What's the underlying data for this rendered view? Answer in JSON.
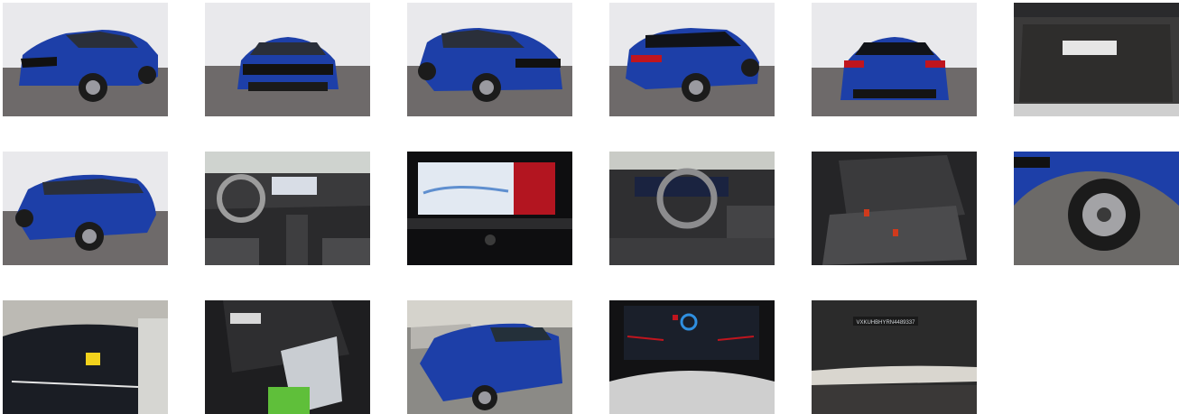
{
  "gallery": {
    "photos": [
      {
        "view": "front-left-exterior",
        "alt": ""
      },
      {
        "view": "front-exterior",
        "alt": ""
      },
      {
        "view": "front-right-exterior",
        "alt": ""
      },
      {
        "view": "rear-right-exterior",
        "alt": ""
      },
      {
        "view": "rear-exterior",
        "alt": ""
      },
      {
        "view": "trunk-interior",
        "alt": ""
      },
      {
        "view": "rear-left-exterior",
        "alt": ""
      },
      {
        "view": "dashboard-interior",
        "alt": ""
      },
      {
        "view": "infotainment-screen",
        "alt": ""
      },
      {
        "view": "driver-seat-steering-wheel",
        "alt": ""
      },
      {
        "view": "rear-seats",
        "alt": ""
      },
      {
        "view": "wheel-closeup",
        "alt": ""
      },
      {
        "view": "roof-closeup",
        "alt": ""
      },
      {
        "view": "glovebox-manual",
        "alt": ""
      },
      {
        "view": "front-lot-exterior",
        "alt": ""
      },
      {
        "view": "instrument-cluster",
        "alt": ""
      },
      {
        "view": "vin-plate",
        "alt": ""
      }
    ],
    "vin_plate_text": "VXKUHBHYRN4489337"
  },
  "colors": {
    "car_body": "#1d3fa8",
    "studio_floor": "#6e6a6a",
    "studio_wall": "#e9e9ec",
    "interior_dark": "#2a2a2c",
    "screen_accent": "#c0151e"
  }
}
